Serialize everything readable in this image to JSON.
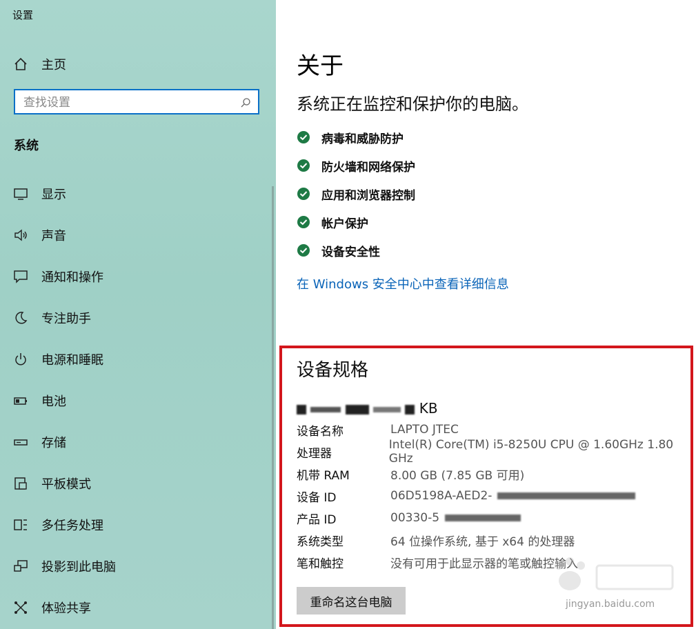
{
  "window": {
    "title": "设置"
  },
  "sidebar": {
    "home_label": "主页",
    "search_placeholder": "查找设置",
    "section": "系统",
    "items": [
      {
        "label": "显示",
        "icon": "monitor-icon"
      },
      {
        "label": "声音",
        "icon": "speaker-icon"
      },
      {
        "label": "通知和操作",
        "icon": "notification-icon"
      },
      {
        "label": "专注助手",
        "icon": "moon-icon"
      },
      {
        "label": "电源和睡眠",
        "icon": "power-icon"
      },
      {
        "label": "电池",
        "icon": "battery-icon"
      },
      {
        "label": "存储",
        "icon": "storage-icon"
      },
      {
        "label": "平板模式",
        "icon": "tablet-icon"
      },
      {
        "label": "多任务处理",
        "icon": "multitask-icon"
      },
      {
        "label": "投影到此电脑",
        "icon": "project-icon"
      },
      {
        "label": "体验共享",
        "icon": "share-icon"
      }
    ]
  },
  "main": {
    "title": "关于",
    "protection_heading": "系统正在监控和保护你的电脑。",
    "protection_items": [
      "病毒和威胁防护",
      "防火墙和网络保护",
      "应用和浏览器控制",
      "帐户保护",
      "设备安全性"
    ],
    "security_link": "在 Windows 安全中心中查看详细信息",
    "specs": {
      "title": "设备规格",
      "device_suffix": "KB",
      "rows": [
        {
          "key": "设备名称",
          "value": "LAPTO          JTEC"
        },
        {
          "key": "处理器",
          "value": "Intel(R) Core(TM) i5-8250U CPU @ 1.60GHz   1.80 GHz"
        },
        {
          "key": "机带 RAM",
          "value": "8.00 GB (7.85 GB 可用)"
        },
        {
          "key": "设备 ID",
          "value": "06D5198A-AED2-"
        },
        {
          "key": "产品 ID",
          "value": "00330-5"
        },
        {
          "key": "系统类型",
          "value": "64 位操作系统, 基于 x64 的处理器"
        },
        {
          "key": "笔和触控",
          "value": "没有可用于此显示器的笔或触控输入"
        }
      ],
      "rename_button": "重命名这台电脑"
    },
    "colors": {
      "accent_link": "#0a64b8",
      "check": "#1e7a45",
      "highlight_frame": "#d3161c"
    }
  },
  "watermark": {
    "text": "jingyan.baidu.com"
  }
}
